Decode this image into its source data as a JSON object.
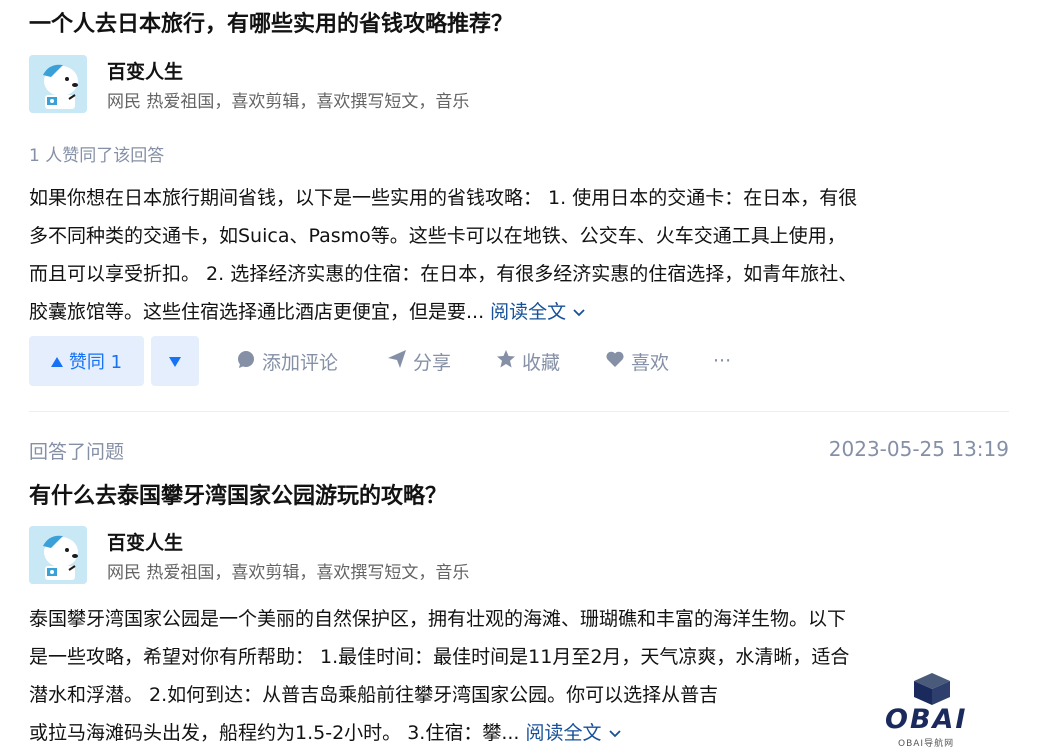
{
  "answer1": {
    "question_title": "一个人去日本旅行，有哪些实用的省钱攻略推荐？",
    "author_name": "百变人生",
    "author_bio": "网民 热爱祖国，喜欢剪辑，喜欢撰写短文，音乐",
    "vote_text": "1 人赞同了该回答",
    "content_lines": [
      "如果你想在日本旅行期间省钱，以下是一些实用的省钱攻略： 1. 使用日本的交通卡：在日本，有很",
      "多不同种类的交通卡，如Suica、Pasmo等。这些卡可以在地铁、公交车、火车交通工具上使用，",
      "而且可以享受折扣。 2. 选择经济实惠的住宿：在日本，有很多经济实惠的住宿选择，如青年旅社、",
      "胶囊旅馆等。这些住宿选择通比酒店更便宜，但是要..."
    ],
    "read_more": "阅读全文",
    "actions": {
      "upvote_label": "赞同 1",
      "comment_label": "添加评论",
      "share_label": "分享",
      "collect_label": "收藏",
      "like_label": "喜欢",
      "more_label": "···"
    }
  },
  "activity": {
    "label": "回答了问题",
    "timestamp": "2023-05-25 13:19"
  },
  "answer2": {
    "question_title": "有什么去泰国攀牙湾国家公园游玩的攻略？",
    "author_name": "百变人生",
    "author_bio": "网民 热爱祖国，喜欢剪辑，喜欢撰写短文，音乐",
    "content_lines": [
      "泰国攀牙湾国家公园是一个美丽的自然保护区，拥有壮观的海滩、珊瑚礁和丰富的海洋生物。以下",
      "是一些攻略，希望对你有所帮助： 1.最佳时间：最佳时间是11月至2月，天气凉爽，水清晰，适合",
      "潜水和浮潜。 2.如何到达：从普吉岛乘船前往攀牙湾国家公园。你可以选择从普吉",
      "或拉马海滩码头出发，船程约为1.5-2小时。 3.住宿：攀..."
    ],
    "read_more": "阅读全文"
  },
  "watermark": {
    "text": "OBAI",
    "subtext": "OBAI导航网"
  },
  "colors": {
    "accent": "#1772f6",
    "link": "#175199",
    "muted": "#8590a6",
    "vote_bg": "#e4eefc"
  }
}
